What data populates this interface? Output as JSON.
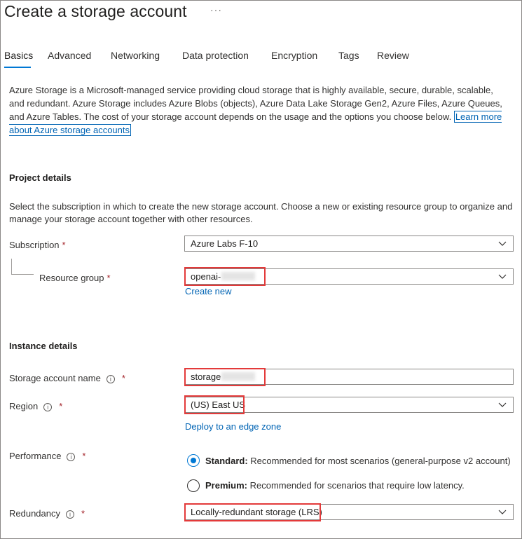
{
  "header": {
    "title": "Create a storage account",
    "more": "···"
  },
  "tabs": [
    {
      "label": "Basics",
      "active": true
    },
    {
      "label": "Advanced"
    },
    {
      "label": "Networking"
    },
    {
      "label": "Data protection"
    },
    {
      "label": "Encryption"
    },
    {
      "label": "Tags"
    },
    {
      "label": "Review"
    }
  ],
  "intro": {
    "text": "Azure Storage is a Microsoft-managed service providing cloud storage that is highly available, secure, durable, scalable, and redundant. Azure Storage includes Azure Blobs (objects), Azure Data Lake Storage Gen2, Azure Files, Azure Queues, and Azure Tables. The cost of your storage account depends on the usage and the options you choose below.",
    "link": "Learn more about Azure storage accounts"
  },
  "project": {
    "heading": "Project details",
    "description": "Select the subscription in which to create the new storage account. Choose a new or existing resource group to organize and manage your storage account together with other resources.",
    "subscription_label": "Subscription",
    "subscription_value": "Azure Labs F-10",
    "resource_group_label": "Resource group",
    "resource_group_value": "openai-",
    "create_new": "Create new"
  },
  "instance": {
    "heading": "Instance details",
    "name_label": "Storage account name",
    "name_value": "storage",
    "region_label": "Region",
    "region_value": "(US) East US",
    "edge_zone_link": "Deploy to an edge zone",
    "performance_label": "Performance",
    "standard_title": "Standard:",
    "standard_desc": "Recommended for most scenarios (general-purpose v2 account)",
    "premium_title": "Premium:",
    "premium_desc": "Recommended for scenarios that require low latency.",
    "redundancy_label": "Redundancy",
    "redundancy_value": "Locally-redundant storage (LRS)"
  },
  "required_marker": "*",
  "info_glyph": "i",
  "colors": {
    "accent": "#0078d4",
    "highlight": "#e33a3a",
    "required": "#a4262c"
  }
}
